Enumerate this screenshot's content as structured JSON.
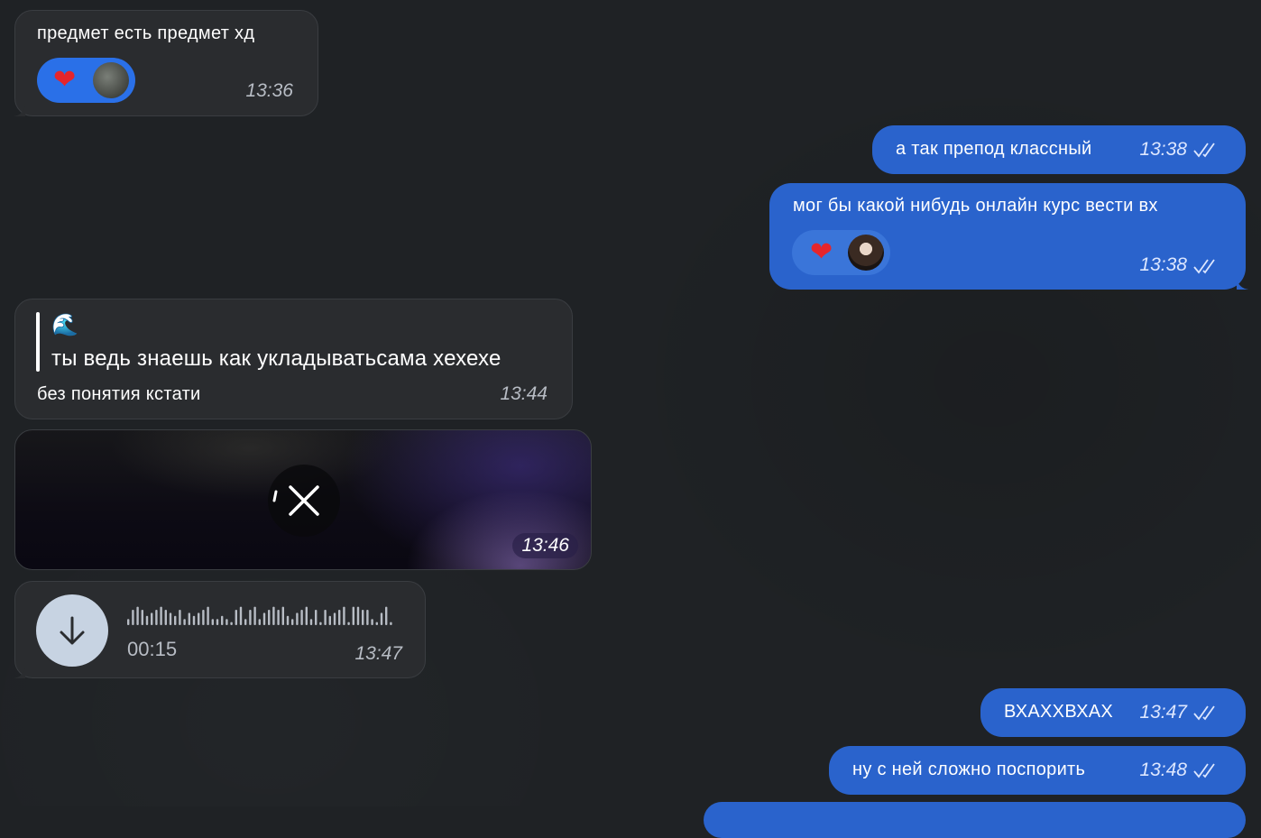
{
  "messages": {
    "m1": {
      "text": "предмет есть предмет хд",
      "time": "13:36",
      "reaction": "heart-reaction"
    },
    "m2": {
      "text": "а так препод классный",
      "time": "13:38"
    },
    "m3": {
      "text": "мог бы какой нибудь онлайн курс вести вх",
      "time": "13:38",
      "reaction": "heart-reaction"
    },
    "m4": {
      "quote_emoji": "🌊",
      "quote_text": "ты ведь знаешь как укладыватьсама хехехе",
      "text": "без понятия кстати",
      "time": "13:44"
    },
    "m5": {
      "time": "13:46",
      "overlay_icon": "close-icon"
    },
    "m6": {
      "duration": "00:15",
      "time": "13:47",
      "icon": "download-arrow-icon"
    },
    "m7": {
      "text": "ВХАХХВХАХ",
      "time": "13:47"
    },
    "m8": {
      "text": "ну с ней сложно поспорить",
      "time": "13:48"
    }
  },
  "colors": {
    "background": "#1f2225",
    "incoming_bubble": "#2a2c2f",
    "outgoing_bubble": "#2a63cc",
    "reaction_chip": "#2a70e8",
    "heart": "#e5252c"
  }
}
